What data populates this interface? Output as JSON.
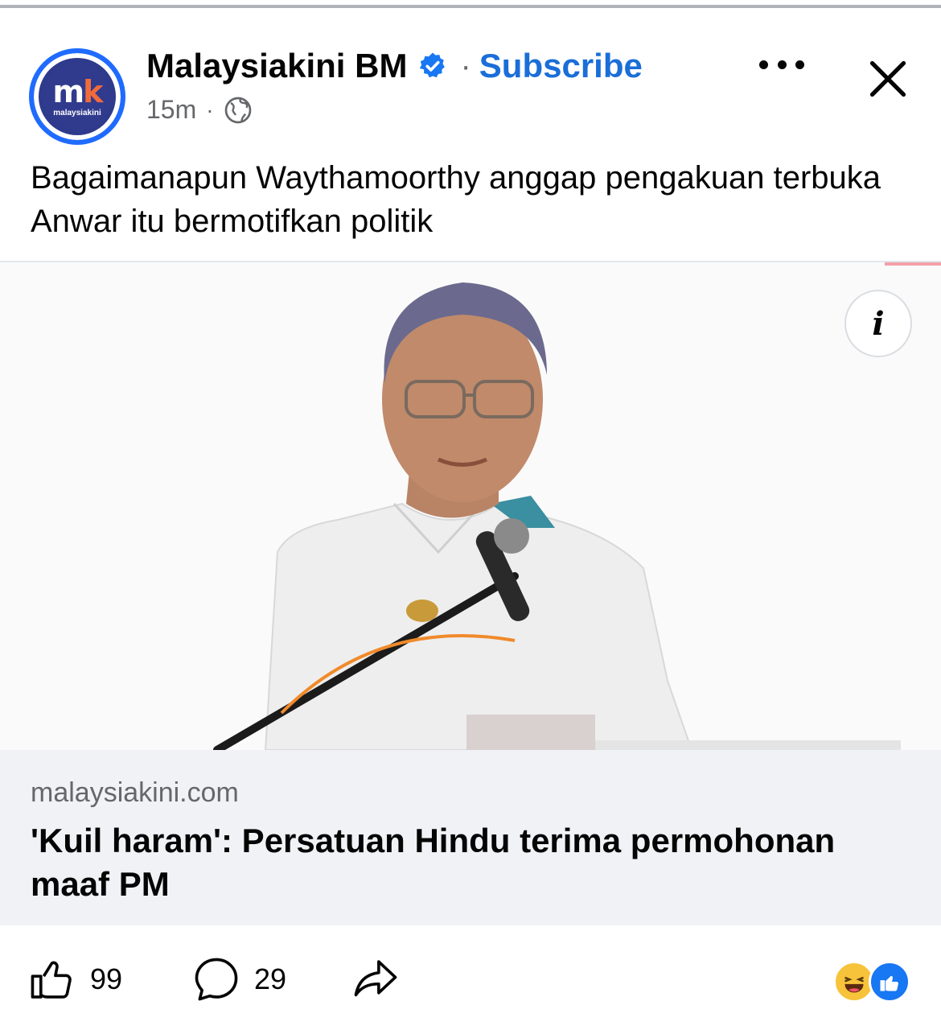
{
  "post": {
    "page_name": "Malaysiakini BM",
    "subscribe_label": "Subscribe",
    "separator": "·",
    "time": "15m",
    "avatar": {
      "mono_m": "m",
      "mono_k": "k",
      "sub": "malaysiakini"
    },
    "caption": "Bagaimanapun Waythamoorthy anggap pengakuan terbuka Anwar itu bermotifkan politik"
  },
  "image": {
    "info_label": "i"
  },
  "link_preview": {
    "domain": "malaysiakini.com",
    "title": "'Kuil haram': Persatuan Hindu terima permohonan maaf PM"
  },
  "actions": {
    "like_count": "99",
    "comment_count": "29"
  },
  "icons": [
    "verified-badge-icon",
    "globe-icon",
    "more-icon",
    "close-icon",
    "info-icon",
    "like-icon",
    "comment-icon",
    "share-icon",
    "haha-reaction-icon",
    "like-reaction-icon"
  ],
  "colors": {
    "accent": "#1a6ed8",
    "secondary_text": "#65676b",
    "link_bg": "#f0f2f5",
    "brand_navy": "#313b8e",
    "brand_orange": "#f26b3a"
  }
}
